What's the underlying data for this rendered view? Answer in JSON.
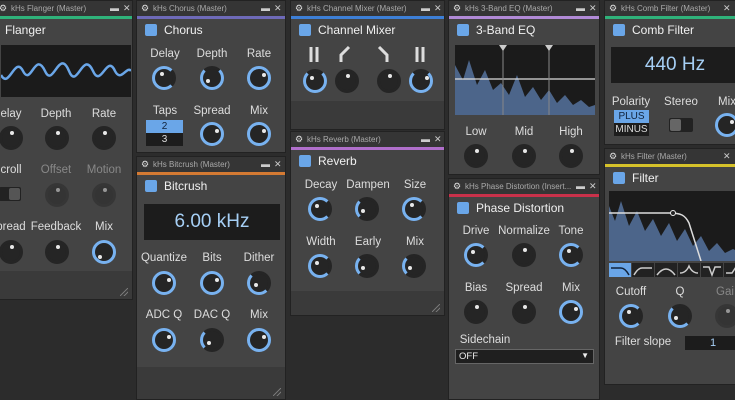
{
  "colors": {
    "accent_flanger": "#2fb27a",
    "accent_chorus": "#6e6ab8",
    "accent_mixer": "#3d7fd6",
    "accent_eq": "#b18ad6",
    "accent_comb": "#2fb27a",
    "accent_bitcrush": "#d47a33",
    "accent_reverb": "#b06fcb",
    "accent_phase": "#c9314a",
    "accent_filter": "#d6c22a",
    "knob_ring": "#78b2f0",
    "value_text": "#a6cff5"
  },
  "icons": {
    "gear": "gear-icon",
    "minimize": "minimize-icon",
    "close": "close-icon",
    "resize": "resize-grip-icon"
  },
  "flanger": {
    "title": "kHs Flanger (Master)",
    "name": "Flanger",
    "labels": {
      "delay": "elay",
      "depth": "Depth",
      "rate": "Rate",
      "scroll": "croll",
      "offset": "Offset",
      "motion": "Motion",
      "spread": "pread",
      "feedback": "Feedback",
      "mix": "Mix"
    }
  },
  "chorus": {
    "title": "kHs Chorus (Master)",
    "name": "Chorus",
    "labels": {
      "delay": "Delay",
      "depth": "Depth",
      "rate": "Rate",
      "taps": "Taps",
      "spread": "Spread",
      "mix": "Mix"
    },
    "taps_options": [
      "2",
      "3"
    ],
    "taps_selected": "2"
  },
  "mixer": {
    "title": "kHs Channel Mixer (Master)",
    "name": "Channel Mixer"
  },
  "eq": {
    "title": "kHs 3-Band EQ (Master)",
    "name": "3-Band EQ",
    "labels": {
      "low": "Low",
      "mid": "Mid",
      "high": "High"
    }
  },
  "comb": {
    "title": "kHs Comb Filter (Master)",
    "name": "Comb Filter",
    "frequency": "440 Hz",
    "labels": {
      "polarity": "Polarity",
      "stereo": "Stereo",
      "mix": "Mix"
    },
    "polarity_options": [
      "PLUS",
      "MINUS"
    ],
    "polarity_selected": "PLUS"
  },
  "bitcrush": {
    "title": "kHs Bitcrush (Master)",
    "name": "Bitcrush",
    "rate": "6.00 kHz",
    "labels": {
      "quantize": "Quantize",
      "bits": "Bits",
      "dither": "Dither",
      "adcq": "ADC Q",
      "dacq": "DAC Q",
      "mix": "Mix"
    }
  },
  "reverb": {
    "title": "kHs Reverb (Master)",
    "name": "Reverb",
    "labels": {
      "decay": "Decay",
      "dampen": "Dampen",
      "size": "Size",
      "width": "Width",
      "early": "Early",
      "mix": "Mix"
    }
  },
  "phase": {
    "title": "kHs Phase Distortion (Insert...",
    "name": "Phase Distortion",
    "labels": {
      "drive": "Drive",
      "normalize": "Normalize",
      "tone": "Tone",
      "bias": "Bias",
      "spread": "Spread",
      "mix": "Mix",
      "sidechain": "Sidechain"
    },
    "sidechain_value": "OFF"
  },
  "filter": {
    "title": "kHs Filter (Master)",
    "name": "Filter",
    "labels": {
      "cutoff": "Cutoff",
      "q": "Q",
      "gain": "Gai",
      "slope": "Filter slope"
    },
    "slope_value": "1"
  }
}
